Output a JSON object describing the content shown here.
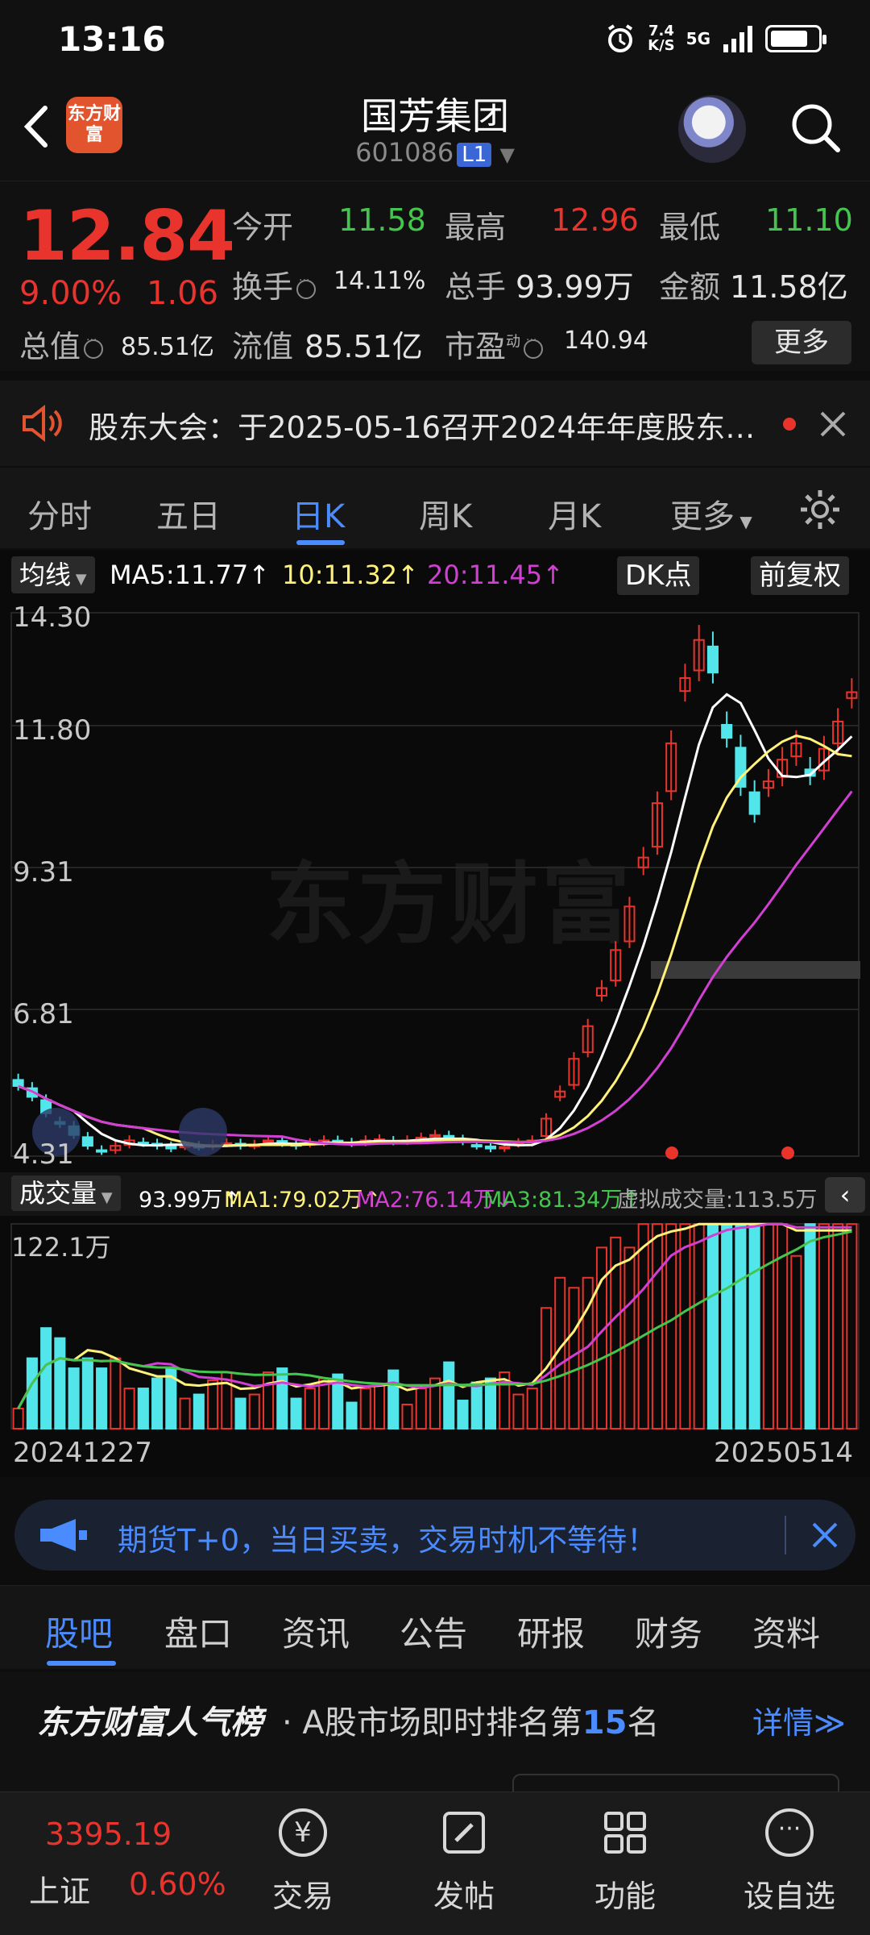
{
  "status_bar": {
    "time": "13:16",
    "net_speed_top": "7.4",
    "net_speed_bottom": "K/S",
    "network": "5G"
  },
  "header": {
    "brand_logo_text": "东方财富",
    "stock_name": "国芳集团",
    "stock_code": "601086",
    "level_badge": "L1"
  },
  "quote": {
    "price": "12.84",
    "change_pct": "9.00%",
    "change_abs": "1.06",
    "open_label": "今开",
    "open": "11.58",
    "high_label": "最高",
    "high": "12.96",
    "low_label": "最低",
    "low": "11.10",
    "turnover_label": "换手",
    "turnover": "14.11%",
    "volume_label": "总手",
    "volume": "93.99万",
    "amount_label": "金额",
    "amount": "11.58亿",
    "mktcap_label": "总值",
    "mktcap": "85.51亿",
    "float_label": "流值",
    "float_cap": "85.51亿",
    "pe_label": "市盈",
    "pe_sup": "动",
    "pe": "140.94",
    "more_label": "更多",
    "colors": {
      "up": "#e8342c",
      "down": "#44c64e"
    }
  },
  "notice": {
    "text": "股东大会：于2025-05-16召开2024年年度股东…"
  },
  "kline_tabs": [
    "分时",
    "五日",
    "日K",
    "周K",
    "月K",
    "更多"
  ],
  "active_kline_tab": "日K",
  "indicator_bar": {
    "ma_select": "均线",
    "ma5": "MA5:11.77↑",
    "ma10": "10:11.32↑",
    "ma20": "20:11.45↑",
    "dk_label": "DK点",
    "adjust_label": "前复权"
  },
  "chart_data": [
    {
      "type": "candlestick",
      "title": "",
      "y_ticks": [
        "14.30",
        "11.80",
        "9.31",
        "6.81",
        "4.31"
      ],
      "ylim": [
        4.31,
        14.3
      ],
      "x_ticks": [
        "20241227",
        "20250514"
      ],
      "watermark": "东方财富",
      "series_colors": {
        "up": "#e8342c",
        "down": "#52e6ea",
        "ma5": "#ffffff",
        "ma10": "#fff27a",
        "ma20": "#d13fd3"
      },
      "closes": [
        5.6,
        5.4,
        5.1,
        4.9,
        4.7,
        4.5,
        4.4,
        4.5,
        4.6,
        4.55,
        4.5,
        4.45,
        4.5,
        4.48,
        4.52,
        4.55,
        4.5,
        4.52,
        4.6,
        4.55,
        4.5,
        4.55,
        4.6,
        4.58,
        4.55,
        4.6,
        4.62,
        4.58,
        4.6,
        4.65,
        4.7,
        4.62,
        4.58,
        4.5,
        4.45,
        4.48,
        4.55,
        4.6,
        5.0,
        5.5,
        6.1,
        6.7,
        7.4,
        8.1,
        8.9,
        9.8,
        10.8,
        11.9,
        13.1,
        13.8,
        13.2,
        12.0,
        11.1,
        10.6,
        11.2,
        11.6,
        11.9,
        11.3,
        11.8,
        12.3,
        12.84
      ],
      "marks": [
        "red-dot",
        "red-dot"
      ]
    },
    {
      "type": "bar",
      "title": "成交量",
      "y_ticks": [
        "122.1万"
      ],
      "legend": [
        "93.99万↑",
        "MA1:79.02万↑",
        "MA2:76.14万↓",
        "MA3:81.34万↑",
        "虚拟成交量:113.5万"
      ],
      "ylim": [
        0,
        122.1
      ]
    }
  ],
  "volume_bar": {
    "select": "成交量",
    "vol": "93.99万↑",
    "ma1": "MA1:79.02万↑",
    "ma2": "MA2:76.14万↓",
    "ma3": "MA3:81.34万↑",
    "virtual": "虚拟成交量:113.5万"
  },
  "promo": {
    "text": "期货T+0，当日买卖，交易时机不等待！"
  },
  "section_tabs": [
    "股吧",
    "盘口",
    "资讯",
    "公告",
    "研报",
    "财务",
    "资料"
  ],
  "active_section_tab": "股吧",
  "popularity": {
    "brand": "东方财富人气榜",
    "prefix": "· A股市场即时排名第",
    "rank": "15",
    "suffix": "名",
    "detail": "详情≫"
  },
  "bottom_nav": {
    "index_value": "3395.19",
    "index_name": "上证",
    "index_change": "0.60%",
    "items": [
      "交易",
      "发帖",
      "功能",
      "设自选"
    ]
  }
}
